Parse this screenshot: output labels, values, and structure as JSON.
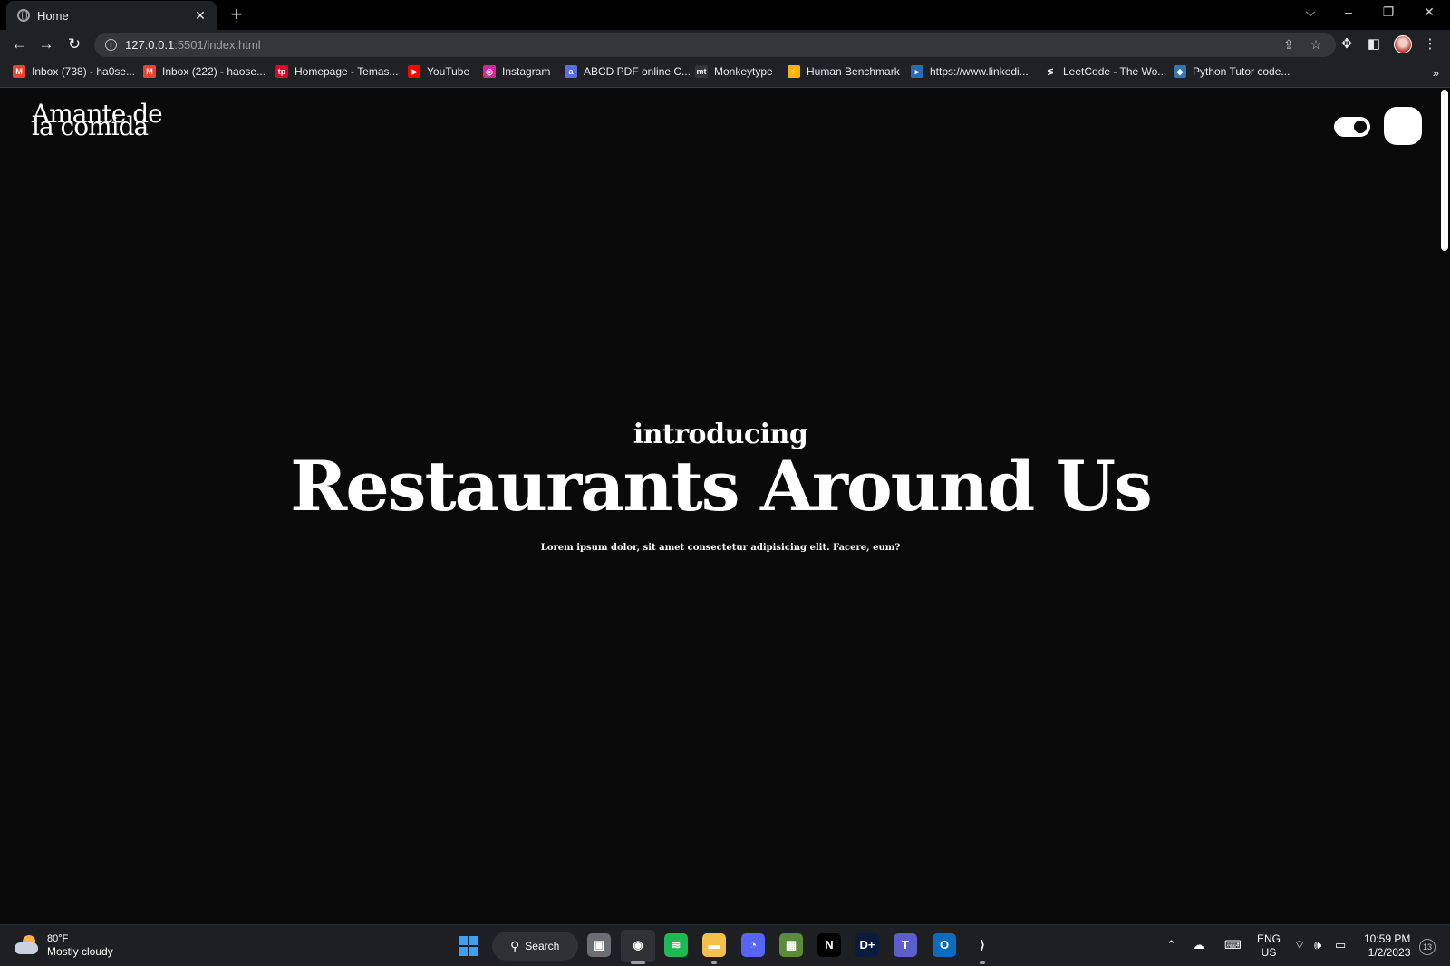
{
  "browser": {
    "tab_title": "Home",
    "new_tab": "+",
    "tab_close": "✕",
    "url_host": "127.0.0.1",
    "url_path": ":5501/index.html",
    "bookmarks": [
      {
        "label": "Inbox (738) - ha0se...",
        "icon": "gmail-icon",
        "color": "#ea4335",
        "glyph": "M"
      },
      {
        "label": "Inbox (222) - haose...",
        "icon": "gmail-icon",
        "color": "#ea4335",
        "glyph": "M"
      },
      {
        "label": "Homepage - Temas...",
        "icon": "tp-icon",
        "color": "#e4002b",
        "glyph": "tp"
      },
      {
        "label": "YouTube",
        "icon": "youtube-icon",
        "color": "#ff0000",
        "glyph": "▶"
      },
      {
        "label": "Instagram",
        "icon": "instagram-icon",
        "color": "#d6249f",
        "glyph": "◎"
      },
      {
        "label": "ABCD PDF online C...",
        "icon": "pdf-icon",
        "color": "#5b6ee1",
        "glyph": "a"
      },
      {
        "label": "Monkeytype",
        "icon": "monkeytype-icon",
        "color": "#323437",
        "glyph": "mt"
      },
      {
        "label": "Human Benchmark",
        "icon": "lightning-icon",
        "color": "#f4b400",
        "glyph": "⚡"
      },
      {
        "label": "https://www.linkedi...",
        "icon": "linkedin-icon",
        "color": "#2b6cb0",
        "glyph": "▸"
      },
      {
        "label": "LeetCode - The Wo...",
        "icon": "leetcode-icon",
        "color": "#202124",
        "glyph": "≶"
      },
      {
        "label": "Python Tutor code...",
        "icon": "python-icon",
        "color": "#3776ab",
        "glyph": "◆"
      }
    ],
    "bookmarks_more": "»"
  },
  "site": {
    "logo_line1": "Amante de",
    "logo_line2": "la comida",
    "hero_intro": "introducing",
    "hero_title": "Restaurants Around Us",
    "hero_sub": "Lorem ipsum dolor, sit amet consectetur adipisicing elit. Facere, eum?"
  },
  "taskbar": {
    "temperature": "80°F",
    "condition": "Mostly cloudy",
    "search_label": "Search",
    "lang": "ENG",
    "region": "US",
    "time": "10:59 PM",
    "date": "1/2/2023",
    "notification_count": "13",
    "apps": [
      {
        "name": "task-view-icon",
        "color": "#6b6e73",
        "glyph": "▣"
      },
      {
        "name": "chrome-icon",
        "color": "#2f3135",
        "glyph": "◉"
      },
      {
        "name": "spotify-icon",
        "color": "#1db954",
        "glyph": "≋"
      },
      {
        "name": "file-explorer-icon",
        "color": "#f3c04a",
        "glyph": "▬"
      },
      {
        "name": "discord-icon",
        "color": "#5865f2",
        "glyph": "◔"
      },
      {
        "name": "minecraft-icon",
        "color": "#5b8c3a",
        "glyph": "▦"
      },
      {
        "name": "netflix-icon",
        "color": "#000000",
        "glyph": "N"
      },
      {
        "name": "disney-plus-icon",
        "color": "#0b1b3f",
        "glyph": "D+"
      },
      {
        "name": "teams-icon",
        "color": "#5b5fc7",
        "glyph": "T"
      },
      {
        "name": "outlook-icon",
        "color": "#0f6cbd",
        "glyph": "O"
      },
      {
        "name": "vscode-icon",
        "color": "#1d1f23",
        "glyph": "⟩"
      }
    ]
  }
}
